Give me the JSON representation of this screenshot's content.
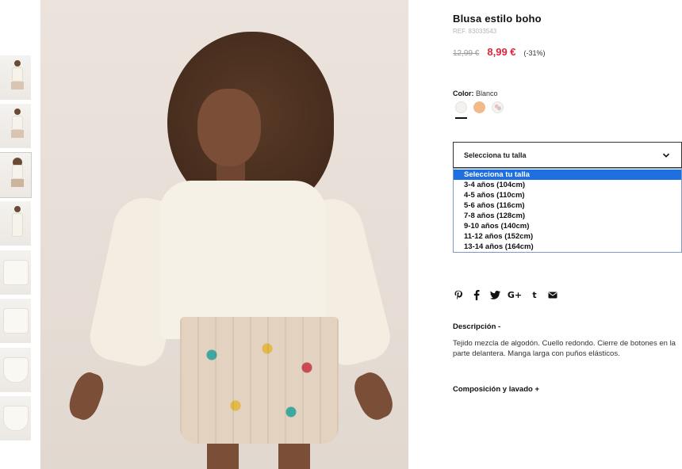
{
  "product": {
    "title": "Blusa estilo boho",
    "ref": "REF. 83033543",
    "old_price": "12,99 €",
    "new_price": "8,99 €",
    "discount": "(-31%)"
  },
  "color": {
    "label": "Color:",
    "value": "Blanco",
    "swatches": [
      "#f3f2ee",
      "#f2b98a",
      "print"
    ]
  },
  "size": {
    "placeholder": "Selecciona tu talla",
    "options": [
      "Selecciona tu talla",
      "3-4 años (104cm)",
      "4-5 años (110cm)",
      "5-6 años (116cm)",
      "7-8 años (128cm)",
      "9-10 años (140cm)",
      "11-12 años (152cm)",
      "13-14 años (164cm)"
    ],
    "selected_index": 0
  },
  "share": {
    "icons": [
      "pinterest-icon",
      "facebook-icon",
      "twitter-icon",
      "google-plus-icon",
      "tumblr-icon",
      "email-icon"
    ],
    "gplus_glyph": "G+",
    "tumblr_glyph": "t"
  },
  "description": {
    "heading": "Descripción  -",
    "body": "Tejido mezcla de algodón. Cuello redondo. Cierre de botones en la parte delantera. Manga larga con puños elásticos."
  },
  "composition": {
    "heading": "Composición y lavado  +"
  },
  "colors": {
    "price_red": "#e0243b",
    "select_highlight": "#1e6fe0"
  }
}
